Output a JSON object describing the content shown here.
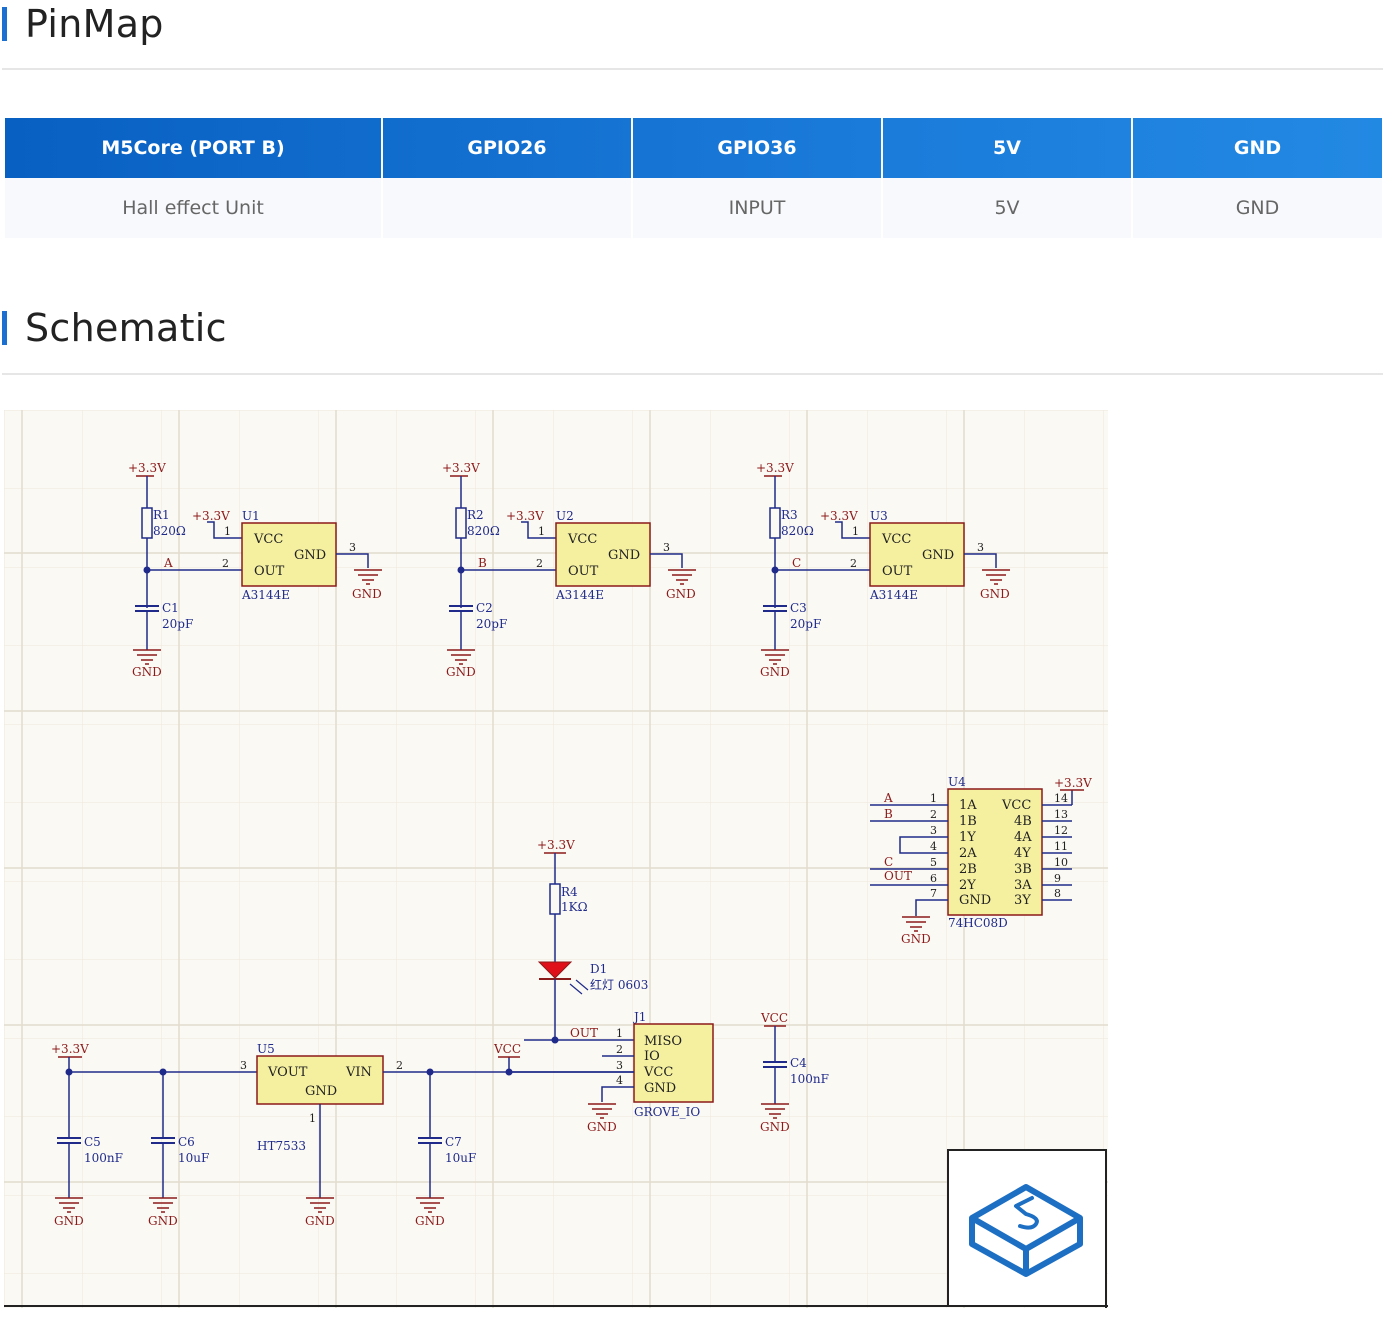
{
  "pinmap": {
    "title": "PinMap",
    "headers": [
      "M5Core (PORT B)",
      "GPIO26",
      "GPIO36",
      "5V",
      "GND"
    ],
    "row": [
      "Hall effect Unit",
      "",
      "INPUT",
      "5V",
      "GND"
    ]
  },
  "schematic": {
    "title": "Schematic",
    "labels": {
      "v33": "+3.3V",
      "gnd": "GND",
      "vcc": "VCC",
      "out": "OUT",
      "r1": "R1",
      "r2": "R2",
      "r3": "R3",
      "r4": "R4",
      "r_val": "820Ω",
      "r4_val": "1KΩ",
      "u1": "U1",
      "u2": "U2",
      "u3": "U3",
      "u4": "U4",
      "u5": "U5",
      "a3144e": "A3144E",
      "c1": "C1",
      "c2": "C2",
      "c3": "C3",
      "c4": "C4",
      "c5": "C5",
      "c6": "C6",
      "c7": "C7",
      "c20pf": "20pF",
      "c100nf": "100nF",
      "c10uf": "10uF",
      "net_a": "A",
      "net_b": "B",
      "net_c": "C",
      "vout": "VOUT",
      "vin": "VIN",
      "ht7533": "HT7533",
      "d1": "D1",
      "d1_val": "红灯 0603",
      "j1": "J1",
      "miso": "MISO",
      "io": "IO",
      "grove": "GROVE_IO",
      "ic74": "74HC08D",
      "p1": "1",
      "p2": "2",
      "p3": "3",
      "p4": "4",
      "p5": "5",
      "p6": "6",
      "p7": "7",
      "p8": "8",
      "p9": "9",
      "p10": "10",
      "p11": "11",
      "p12": "12",
      "p13": "13",
      "p14": "14",
      "g1a": "1A",
      "g1b": "1B",
      "g1y": "1Y",
      "g2a": "2A",
      "g2b": "2B",
      "g2y": "2Y",
      "g4b": "4B",
      "g4a": "4A",
      "g4y": "4Y",
      "g3b": "3B",
      "g3a": "3A",
      "g3y": "3Y"
    }
  },
  "colors": {
    "accent": "#1a6fd0",
    "wire": "#1f2a8a",
    "part": "#f5f0a0",
    "power": "#8b1a1a",
    "led": "#e0101a"
  },
  "icons": {
    "logo": "m5stack-logo-icon"
  }
}
